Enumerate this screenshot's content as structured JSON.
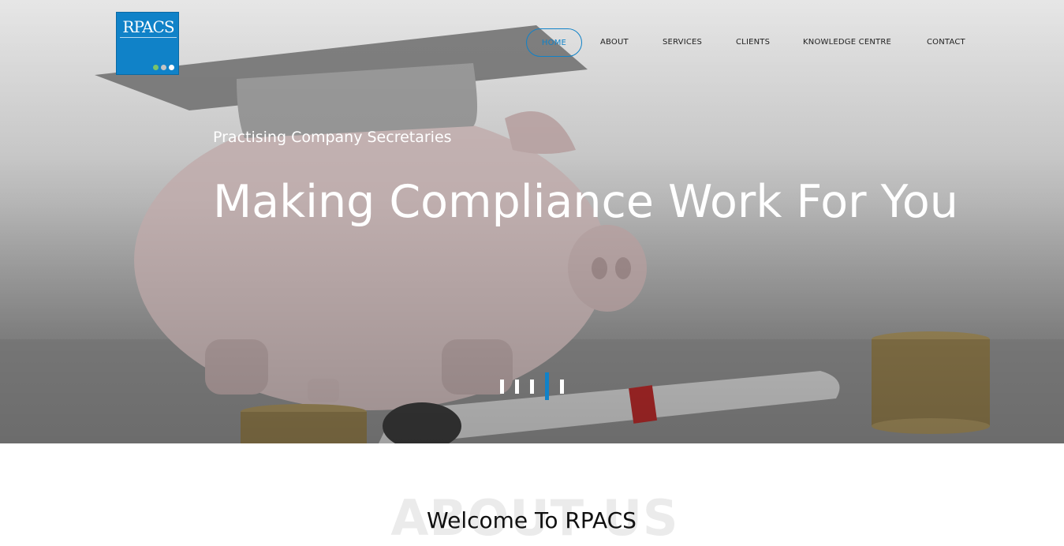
{
  "brand": {
    "logo_text": "RPACS",
    "accent_color": "#1082c8"
  },
  "nav": {
    "items": [
      {
        "label": "HOME",
        "active": true
      },
      {
        "label": "ABOUT",
        "active": false
      },
      {
        "label": "SERVICES",
        "active": false
      },
      {
        "label": "CLIENTS",
        "active": false
      },
      {
        "label": "KNOWLEDGE CENTRE",
        "active": false
      },
      {
        "label": "CONTACT",
        "active": false
      }
    ]
  },
  "hero": {
    "subtitle": "Practising Company Secretaries",
    "headline": "Making Compliance Work For You",
    "slides_total": 5,
    "active_slide": 4
  },
  "about": {
    "background_word": "ABOUT US",
    "heading": "Welcome To RPACS"
  }
}
